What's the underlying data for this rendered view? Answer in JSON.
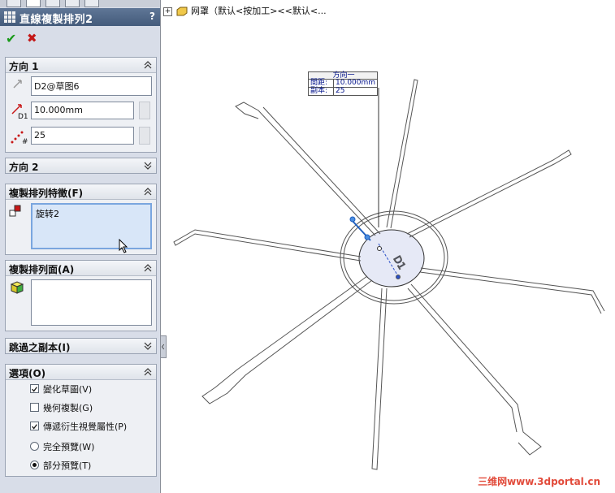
{
  "feature_manager": {
    "title": "直線複製排列2",
    "help": "?",
    "ok_label": "✔",
    "cancel_label": "✖"
  },
  "direction1": {
    "header": "方向 1",
    "edge_value": "D2@草图6",
    "spacing_value": "10.000mm",
    "count_value": "25",
    "spacing_tag": "D1"
  },
  "direction2": {
    "header": "方向 2"
  },
  "features_to_pattern": {
    "header": "複製排列特徵(F)",
    "items": [
      "旋转2"
    ]
  },
  "faces_to_pattern": {
    "header": "複製排列面(A)"
  },
  "instances_to_skip": {
    "header": "跳過之副本(I)"
  },
  "options": {
    "header": "選項(O)",
    "vary_sketch": "變化草圖(V)",
    "geometry_pattern": "幾何複製(G)",
    "propagate_visual": "傳遞衍生視覺屬性(P)",
    "full_preview": "完全預覽(W)",
    "partial_preview": "部分預覽(T)",
    "vary_sketch_checked": true,
    "geometry_pattern_checked": false,
    "propagate_visual_checked": true,
    "preview_mode": "partial"
  },
  "tree": {
    "label": "网罩（默认<按加工><<默认<..."
  },
  "callout": {
    "title": "方向一",
    "spacing_label": "間距:",
    "spacing_value": "10.000mm",
    "count_label": "副本:",
    "count_value": "25"
  },
  "watermark": "三维网www.3dportal.cn"
}
